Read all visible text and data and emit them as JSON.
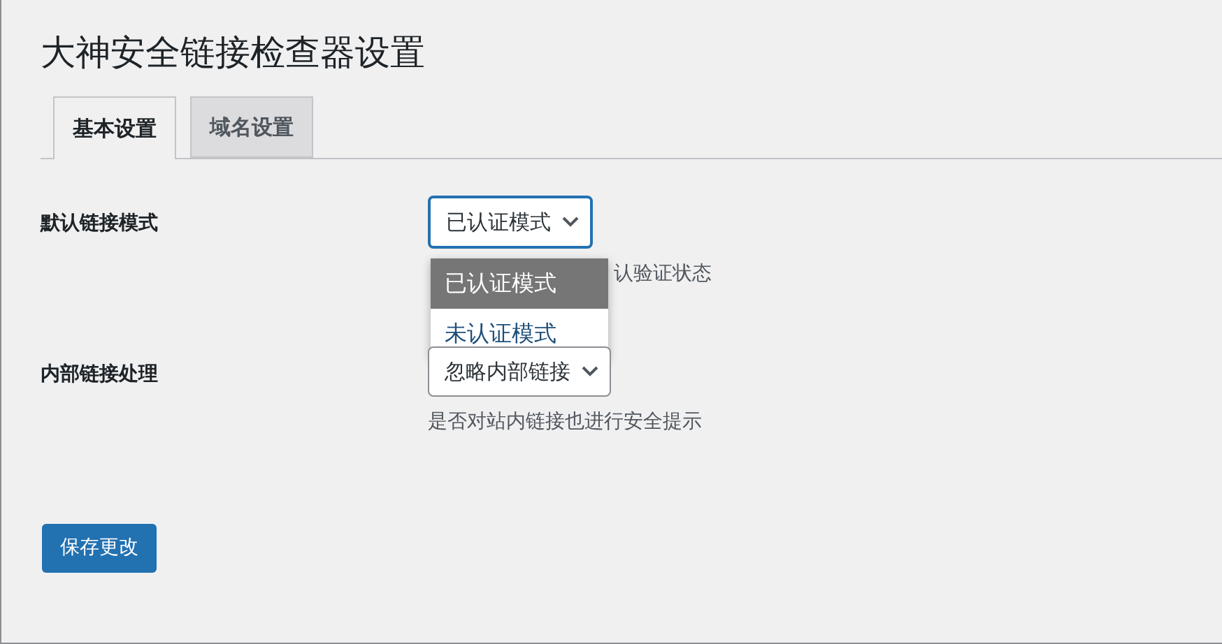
{
  "title": "大神安全链接检查器设置",
  "tabs": [
    {
      "label": "基本设置",
      "selected": true
    },
    {
      "label": "域名设置",
      "selected": false
    }
  ],
  "settings": [
    {
      "label": "默认链接模式",
      "select_value": "已认证模式",
      "focused": true,
      "description": "认验证状态",
      "dropdown": {
        "options": [
          {
            "label": "已认证模式",
            "selected": true
          },
          {
            "label": "未认证模式",
            "selected": false
          }
        ]
      }
    },
    {
      "label": "内部链接处理",
      "select_value": "忽略内部链接",
      "focused": false,
      "description": "是否对站内链接也进行安全提示"
    }
  ],
  "save_button": "保存更改"
}
